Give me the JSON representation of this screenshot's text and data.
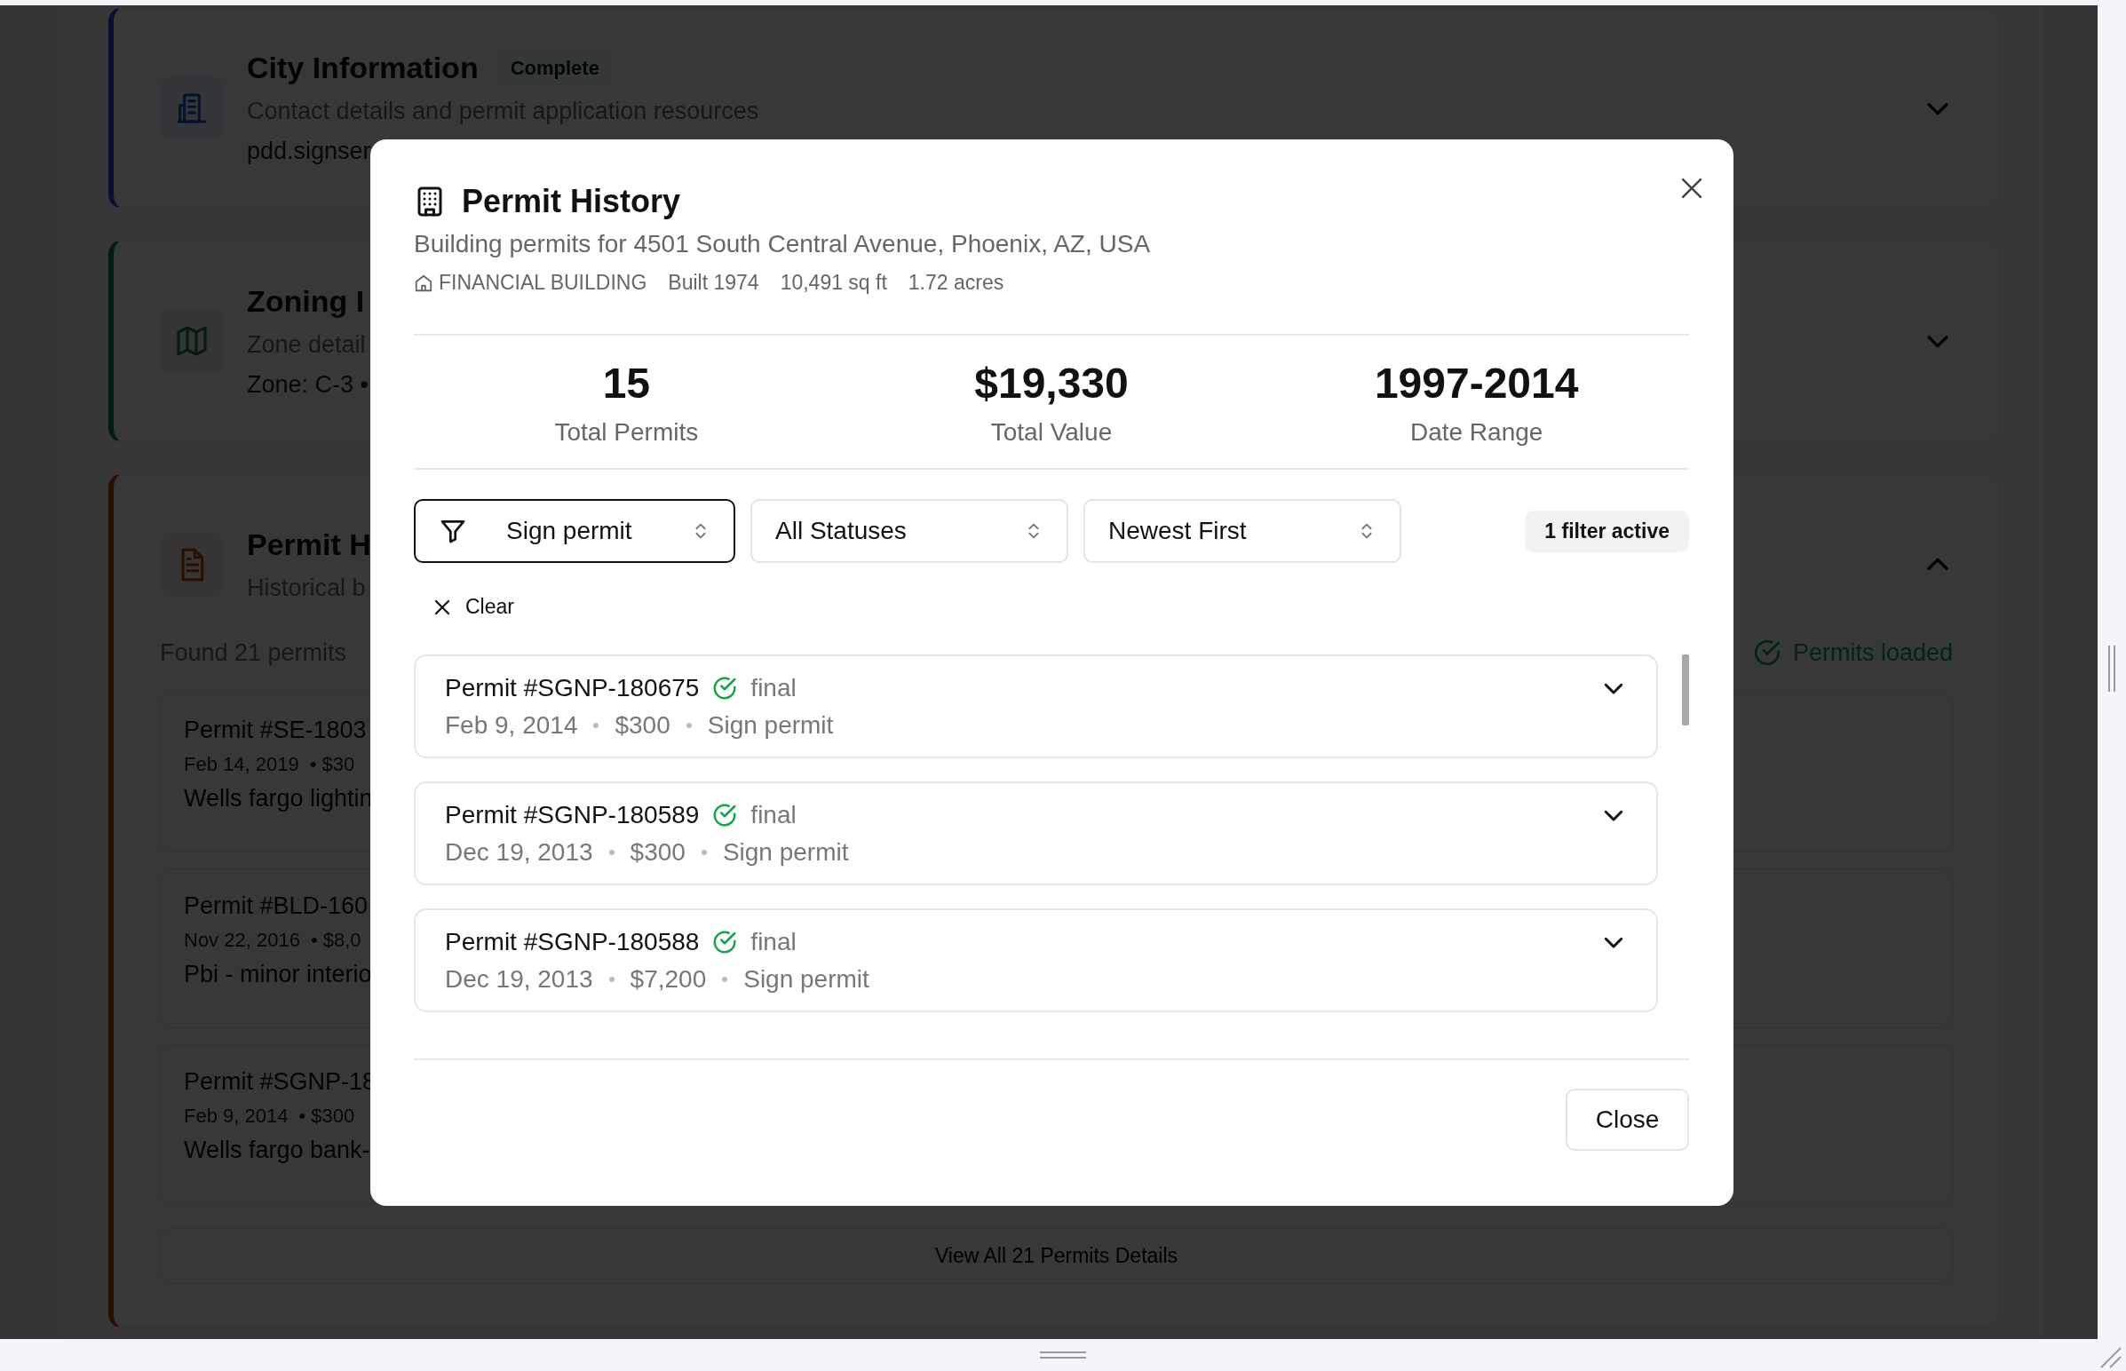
{
  "background": {
    "cards": [
      {
        "kind": "city",
        "title": "City Information",
        "badge": "Complete",
        "subtitle": "Contact details and permit application resources",
        "detail": "pdd.signser",
        "expanded": false
      },
      {
        "kind": "zoning",
        "title": "Zoning I",
        "subtitle": "Zone detail",
        "detail": "Zone: C-3 •",
        "expanded": false
      },
      {
        "kind": "permits",
        "title": "Permit H",
        "subtitle": "Historical b",
        "expanded": true,
        "found": "Found 21 permits",
        "status": "Permits loaded",
        "permits": [
          {
            "id": "Permit #SE-1803",
            "date": "Feb 14, 2019",
            "value": "• $30",
            "description": "Wells fargo lightin"
          },
          {
            "id": "Permit #BLD-160",
            "date": "Nov 22, 2016",
            "value": "• $8,0",
            "description": "Pbi - minor interio"
          },
          {
            "id": "Permit #SGNP-18",
            "date": "Feb 9, 2014",
            "value": "• $300",
            "description": "Wells fargo bank-"
          }
        ],
        "view_all": "View All 21 Permits Details"
      }
    ]
  },
  "modal": {
    "title": "Permit History",
    "subtitle": "Building permits for 4501 South Central Avenue, Phoenix, AZ, USA",
    "meta": [
      "FINANCIAL BUILDING",
      "Built 1974",
      "10,491 sq ft",
      "1.72 acres"
    ],
    "stats": [
      {
        "value": "15",
        "label": "Total Permits"
      },
      {
        "value": "$19,330",
        "label": "Total Value"
      },
      {
        "value": "1997-2014",
        "label": "Date Range"
      }
    ],
    "filters": [
      {
        "kind": "type",
        "value": "Sign permit",
        "active": true
      },
      {
        "kind": "status",
        "value": "All Statuses",
        "active": false
      },
      {
        "kind": "sort",
        "value": "Newest First",
        "active": false
      }
    ],
    "filter_badge": "1 filter active",
    "clear": "Clear",
    "permits": [
      {
        "id": "Permit #SGNP-180675",
        "status": "final",
        "date": "Feb 9, 2014",
        "value": "$300",
        "type": "Sign permit",
        "expanded": false
      },
      {
        "id": "Permit #SGNP-180589",
        "status": "final",
        "date": "Dec 19, 2013",
        "value": "$300",
        "type": "Sign permit",
        "expanded": false
      },
      {
        "id": "Permit #SGNP-180588",
        "status": "final",
        "date": "Dec 19, 2013",
        "value": "$7,200",
        "type": "Sign permit",
        "expanded": false
      }
    ],
    "close_button": "Close"
  }
}
